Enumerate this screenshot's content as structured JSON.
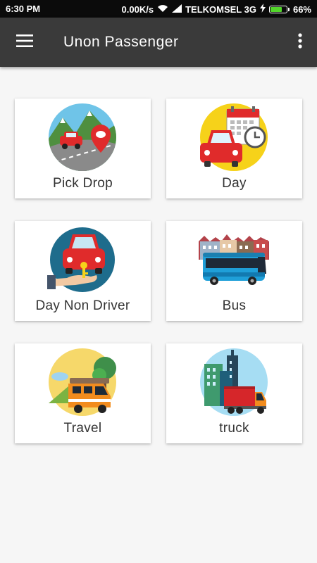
{
  "status_bar": {
    "time": "6:30 PM",
    "speed": "0.00K/s",
    "carrier": "TELKOMSEL 3G",
    "battery": "66%",
    "battery_level": 0.66
  },
  "app_bar": {
    "title": "Unon Passenger",
    "menu_icon": "hamburger-menu-icon",
    "more_icon": "more-vert-icon"
  },
  "menu": [
    {
      "label": "Pick Drop",
      "icon": "pick-drop-icon"
    },
    {
      "label": "Day",
      "icon": "day-rental-icon"
    },
    {
      "label": "Day Non Driver",
      "icon": "car-key-icon"
    },
    {
      "label": "Bus",
      "icon": "bus-icon"
    },
    {
      "label": "Travel",
      "icon": "travel-van-icon"
    },
    {
      "label": "truck",
      "icon": "truck-icon"
    }
  ]
}
